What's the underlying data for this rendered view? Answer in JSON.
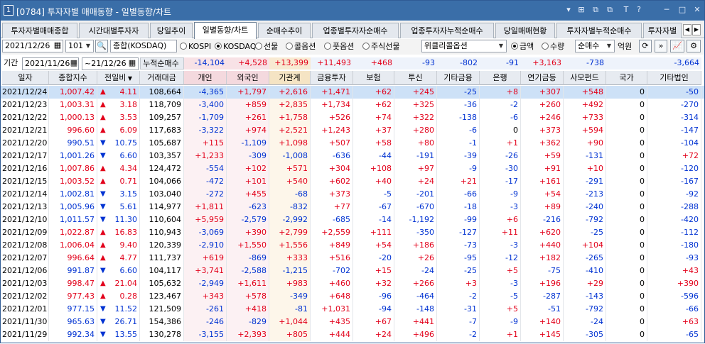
{
  "window": {
    "number": "1",
    "title": "[0784] 투자자별 매매동향 - 일별동향/차트",
    "controls": [
      "▾",
      "⊞",
      "⧉",
      "⧉",
      "T",
      "?",
      "─",
      "□",
      "✕"
    ]
  },
  "tabs": [
    "투자자별매매종합",
    "시간대별투자자",
    "당일추이",
    "일별동향/차트",
    "순매수추이",
    "업종별투자자순매수",
    "업종투자자누적순매수",
    "당일매매현황",
    "투자자별누적순매수",
    "투자자별"
  ],
  "controls": {
    "date": "2021/12/26",
    "code": "101",
    "market_name": "종합(KOSDAQ)",
    "market_options": [
      {
        "label": "KOSPI",
        "on": false
      },
      {
        "label": "KOSDAQ",
        "on": true
      },
      {
        "label": "선물",
        "on": false
      },
      {
        "label": "콜옵션",
        "on": false
      },
      {
        "label": "풋옵션",
        "on": false
      },
      {
        "label": "주식선물",
        "on": false
      }
    ],
    "option_select": "위클리콜옵션",
    "unit_options": [
      {
        "label": "금액",
        "on": true
      },
      {
        "label": "수량",
        "on": false
      }
    ],
    "order_select": "순매수",
    "unit_label": "억원"
  },
  "period": {
    "label": "기간",
    "from": "2021/11/26",
    "to": "21/12/26",
    "cum_label": "누적순매수"
  },
  "cumulative": [
    "-14,104",
    "+4,528",
    "+13,399",
    "+11,493",
    "+468",
    "-93",
    "-802",
    "-91",
    "+3,163",
    "-738",
    "",
    "-3,664"
  ],
  "columns": [
    "일자",
    "종합지수",
    "전일비",
    "거래대금",
    "개인",
    "외국인",
    "기관계",
    "금융투자",
    "보험",
    "투신",
    "기타금융",
    "은행",
    "연기금등",
    "사모펀드",
    "국가",
    "기타법인"
  ],
  "rows": [
    [
      "2021/12/24",
      "1,007.42",
      "▲",
      "4.11",
      "108,664",
      "-4,365",
      "+1,797",
      "+2,616",
      "+1,471",
      "+62",
      "+245",
      "-25",
      "+8",
      "+307",
      "+548",
      "0",
      "-50"
    ],
    [
      "2021/12/23",
      "1,003.31",
      "▲",
      "3.18",
      "118,709",
      "-3,400",
      "+859",
      "+2,835",
      "+1,734",
      "+62",
      "+325",
      "-36",
      "-2",
      "+260",
      "+492",
      "0",
      "-270"
    ],
    [
      "2021/12/22",
      "1,000.13",
      "▲",
      "3.53",
      "109,257",
      "-1,709",
      "+261",
      "+1,758",
      "+526",
      "+74",
      "+322",
      "-138",
      "-6",
      "+246",
      "+733",
      "0",
      "-314"
    ],
    [
      "2021/12/21",
      "996.60",
      "▲",
      "6.09",
      "117,683",
      "-3,322",
      "+974",
      "+2,521",
      "+1,243",
      "+37",
      "+280",
      "-6",
      "0",
      "+373",
      "+594",
      "0",
      "-147"
    ],
    [
      "2021/12/20",
      "990.51",
      "▼",
      "10.75",
      "105,687",
      "+115",
      "-1,109",
      "+1,098",
      "+507",
      "+58",
      "+80",
      "-1",
      "+1",
      "+362",
      "+90",
      "0",
      "-104"
    ],
    [
      "2021/12/17",
      "1,001.26",
      "▼",
      "6.60",
      "103,357",
      "+1,233",
      "-309",
      "-1,008",
      "-636",
      "-44",
      "-191",
      "-39",
      "-26",
      "+59",
      "-131",
      "0",
      "+72"
    ],
    [
      "2021/12/16",
      "1,007.86",
      "▲",
      "4.34",
      "124,472",
      "-554",
      "+102",
      "+571",
      "+304",
      "+108",
      "+97",
      "-9",
      "-30",
      "+91",
      "+10",
      "0",
      "-120"
    ],
    [
      "2021/12/15",
      "1,003.52",
      "▲",
      "0.71",
      "104,066",
      "-472",
      "+101",
      "+540",
      "+602",
      "+40",
      "+24",
      "+21",
      "-17",
      "+161",
      "-291",
      "0",
      "-167"
    ],
    [
      "2021/12/14",
      "1,002.81",
      "▼",
      "3.15",
      "103,040",
      "-272",
      "+455",
      "-68",
      "+373",
      "-5",
      "-201",
      "-66",
      "-9",
      "+54",
      "-213",
      "0",
      "-92"
    ],
    [
      "2021/12/13",
      "1,005.96",
      "▼",
      "5.61",
      "114,977",
      "+1,811",
      "-623",
      "-832",
      "+77",
      "-67",
      "-670",
      "-18",
      "-3",
      "+89",
      "-240",
      "0",
      "-288"
    ],
    [
      "2021/12/10",
      "1,011.57",
      "▼",
      "11.30",
      "110,604",
      "+5,959",
      "-2,579",
      "-2,992",
      "-685",
      "-14",
      "-1,192",
      "-99",
      "+6",
      "-216",
      "-792",
      "0",
      "-420"
    ],
    [
      "2021/12/09",
      "1,022.87",
      "▲",
      "16.83",
      "110,943",
      "-3,069",
      "+390",
      "+2,799",
      "+2,559",
      "+111",
      "-350",
      "-127",
      "+11",
      "+620",
      "-25",
      "0",
      "-112"
    ],
    [
      "2021/12/08",
      "1,006.04",
      "▲",
      "9.40",
      "120,339",
      "-2,910",
      "+1,550",
      "+1,556",
      "+849",
      "+54",
      "+186",
      "-73",
      "-3",
      "+440",
      "+104",
      "0",
      "-180"
    ],
    [
      "2021/12/07",
      "996.64",
      "▲",
      "4.77",
      "111,737",
      "+619",
      "-869",
      "+333",
      "+516",
      "-20",
      "+26",
      "-95",
      "-12",
      "+182",
      "-265",
      "0",
      "-93"
    ],
    [
      "2021/12/06",
      "991.87",
      "▼",
      "6.60",
      "104,117",
      "+3,741",
      "-2,588",
      "-1,215",
      "-702",
      "+15",
      "-24",
      "-25",
      "+5",
      "-75",
      "-410",
      "0",
      "+43"
    ],
    [
      "2021/12/03",
      "998.47",
      "▲",
      "21.04",
      "105,632",
      "-2,949",
      "+1,611",
      "+983",
      "+460",
      "+32",
      "+266",
      "+3",
      "-3",
      "+196",
      "+29",
      "0",
      "+390"
    ],
    [
      "2021/12/02",
      "977.43",
      "▲",
      "0.28",
      "123,467",
      "+343",
      "+578",
      "-349",
      "+648",
      "-96",
      "-464",
      "-2",
      "-5",
      "-287",
      "-143",
      "0",
      "-596"
    ],
    [
      "2021/12/01",
      "977.15",
      "▼",
      "11.52",
      "121,509",
      "-261",
      "+418",
      "-81",
      "+1,031",
      "-94",
      "-148",
      "-31",
      "+5",
      "-51",
      "-792",
      "0",
      "-66"
    ],
    [
      "2021/11/30",
      "965.63",
      "▼",
      "26.71",
      "154,386",
      "-246",
      "-829",
      "+1,044",
      "+435",
      "+67",
      "+441",
      "-7",
      "-9",
      "+140",
      "-24",
      "0",
      "+63"
    ],
    [
      "2021/11/29",
      "992.34",
      "▼",
      "13.55",
      "130,278",
      "-3,155",
      "+2,393",
      "+805",
      "+444",
      "+24",
      "+496",
      "-2",
      "+1",
      "+145",
      "-305",
      "0",
      "-65"
    ]
  ]
}
